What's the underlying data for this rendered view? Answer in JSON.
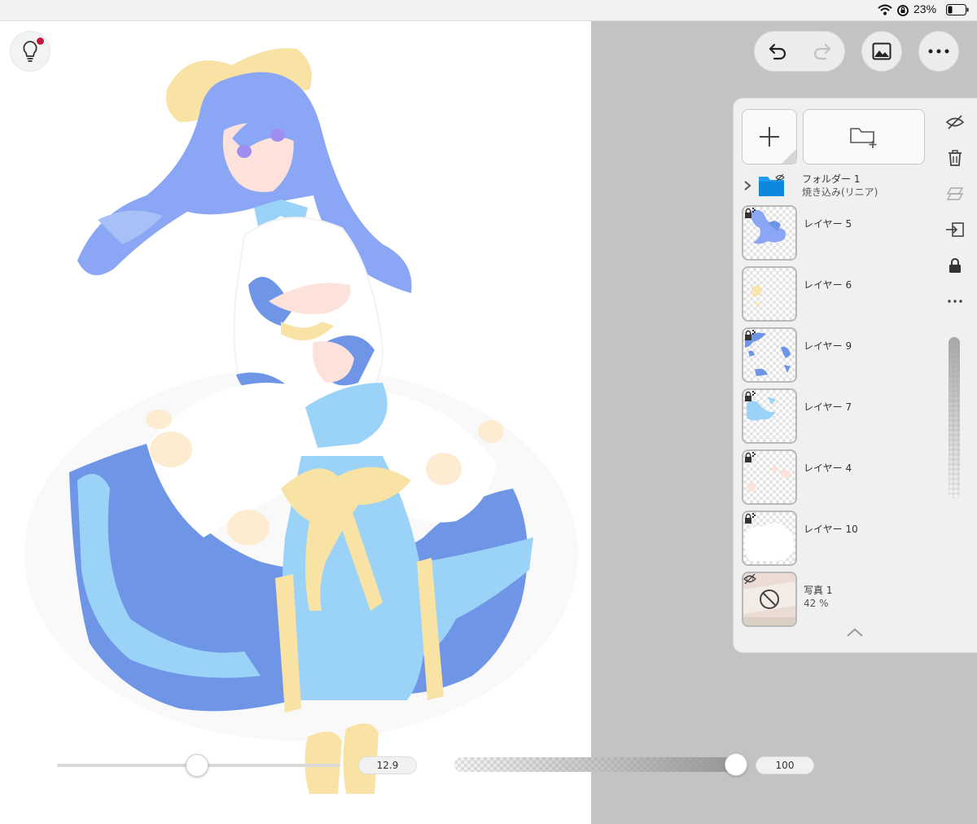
{
  "status_bar": {
    "battery_text": "23%",
    "icons": [
      "wifi-icon",
      "rotation-lock-icon",
      "battery-icon"
    ]
  },
  "canvas": {
    "content": "illustration-of-girl-with-blue-hair-and-dress",
    "background": "#ffffff"
  },
  "toolbar": {
    "hint_icon": "lightbulb-icon",
    "undo_icon": "undo-icon",
    "redo_icon": "redo-icon",
    "gallery_icon": "gallery-icon",
    "more_icon": "more-icon"
  },
  "layers_panel": {
    "add_layer_icon": "plus-icon",
    "add_folder_icon": "new-folder-icon",
    "folder": {
      "name": "フォルダー 1",
      "blend_mode": "焼き込み(リニア)"
    },
    "layers": [
      {
        "name": "レイヤー 5"
      },
      {
        "name": "レイヤー 6"
      },
      {
        "name": "レイヤー 9"
      },
      {
        "name": "レイヤー 7"
      },
      {
        "name": "レイヤー 4"
      },
      {
        "name": "レイヤー 10"
      },
      {
        "name": "写真 1",
        "opacity": "42 %"
      }
    ],
    "side_tools": [
      "hide-icon",
      "trash-icon",
      "merge-icon",
      "move-icon",
      "lock-icon",
      "more-icon"
    ]
  },
  "brush": {
    "size_value": "12.9",
    "opacity_value": "100"
  },
  "colors": {
    "accent_red": "#c4173a",
    "folder_blue": "#1e9bf0",
    "hair_blue": "#8aa6f5",
    "dress_blue": "#6f95e6",
    "light_blue": "#9bd3f8",
    "ribbon_yellow": "#f8e2a4"
  }
}
